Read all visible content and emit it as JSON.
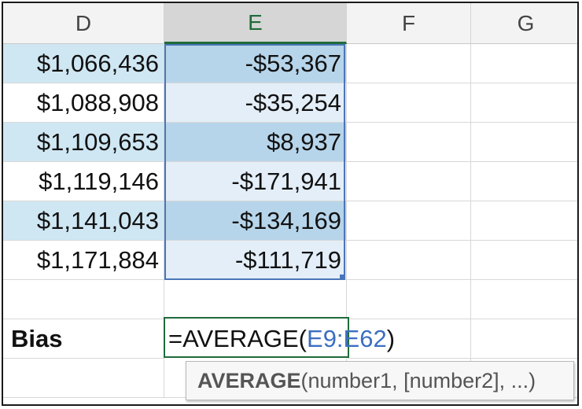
{
  "columns": {
    "d": "D",
    "e": "E",
    "f": "F",
    "g": "G"
  },
  "rows": [
    {
      "d": "$1,066,436",
      "e": "-$53,367"
    },
    {
      "d": "$1,088,908",
      "e": "-$35,254"
    },
    {
      "d": "$1,109,653",
      "e": "$8,937"
    },
    {
      "d": "$1,119,146",
      "e": "-$171,941"
    },
    {
      "d": "$1,141,043",
      "e": "-$134,169"
    },
    {
      "d": "$1,171,884",
      "e": "-$111,719"
    }
  ],
  "bias_row": {
    "label": "Bias",
    "formula_prefix": "=AVERAGE(",
    "formula_ref": "E9:E62",
    "formula_suffix": ")"
  },
  "tooltip": {
    "function_name": "AVERAGE",
    "args": "(number1, [number2], ...)"
  },
  "colors": {
    "selected_header_accent": "#1f6b3a",
    "range_border": "#4a76b8",
    "formula_ref": "#3b6fc1",
    "band_d": "#cfe7f3",
    "band_e_dark": "#b7d5ea",
    "band_e_light": "#e3eef8"
  }
}
